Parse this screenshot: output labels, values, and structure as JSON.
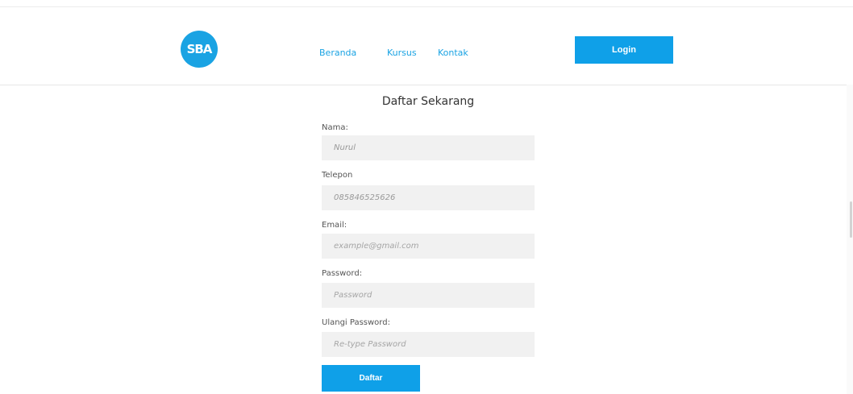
{
  "header": {
    "logo_text": "SBA",
    "nav": [
      {
        "label": "Beranda"
      },
      {
        "label": "Kursus"
      },
      {
        "label": "Kontak"
      }
    ],
    "login_label": "Login"
  },
  "form": {
    "title": "Daftar Sekarang",
    "fields": [
      {
        "label": "Nama:",
        "value": "Nurul",
        "placeholder": ""
      },
      {
        "label": "Telepon",
        "value": "085846525626",
        "placeholder": ""
      },
      {
        "label": "Email:",
        "value": "",
        "placeholder": "example@gmail.com"
      },
      {
        "label": "Password:",
        "value": "",
        "placeholder": "Password"
      },
      {
        "label": "Ulangi Password:",
        "value": "",
        "placeholder": "Re-type Password"
      }
    ],
    "submit_label": "Daftar"
  },
  "colors": {
    "accent": "#0fa0e8",
    "input_bg": "#f1f1f1"
  }
}
